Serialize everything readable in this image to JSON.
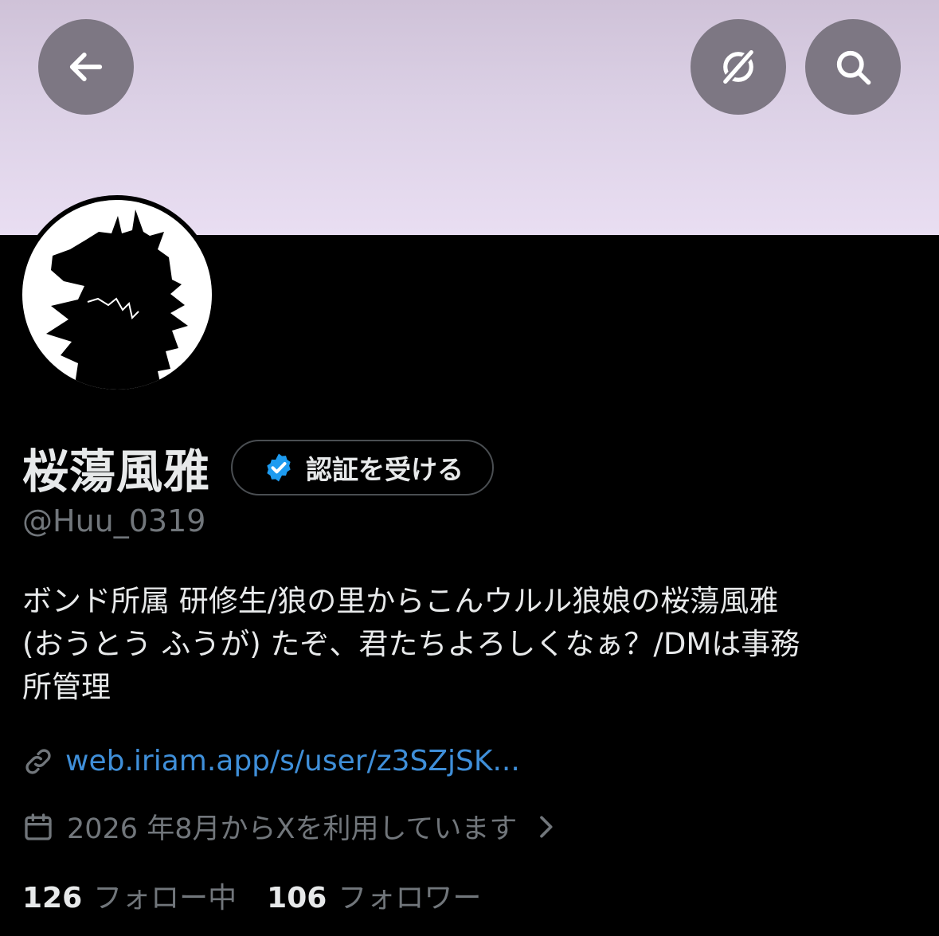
{
  "profile": {
    "display_name": "桜蕩風雅",
    "handle": "@Huu_0319",
    "verify_label": "認証を受ける",
    "bio_lines": [
      "ボンド所属 研修生/狼の里からこんウルル狼娘の桜蕩風雅",
      "(おうとう ふうが) たぞ、君たちよろしくなぁ？/DMは事務",
      "所管理"
    ],
    "link": "web.iriam.app/s/user/z3SZjSK...",
    "joined": "2026 年8月からXを利用しています",
    "following_count": "126",
    "following_label": "フォロー中",
    "followers_count": "106",
    "followers_label": "フォロワー"
  },
  "icons": {
    "back": "arrow-left-icon",
    "grok": "grok-icon",
    "search": "search-icon",
    "verified": "verified-badge-icon",
    "link": "link-icon",
    "calendar": "calendar-icon",
    "chevron": "chevron-right-icon",
    "avatar": "wolf-silhouette"
  },
  "colors": {
    "accent": "#1d9bf0",
    "link": "#3f8fd9",
    "muted": "#71767b",
    "button_bg": "#7d7783"
  }
}
